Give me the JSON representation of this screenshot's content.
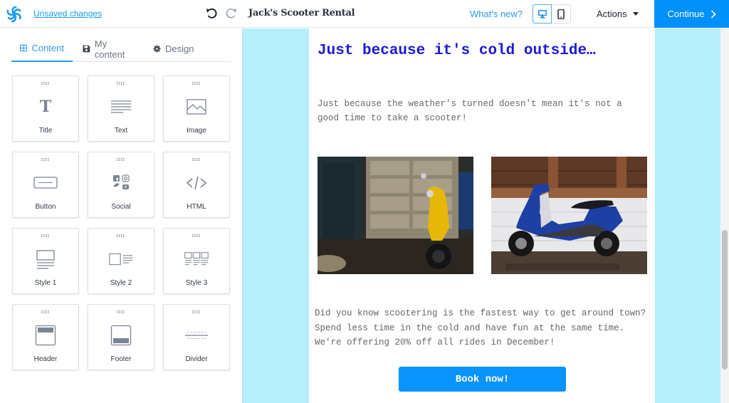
{
  "topbar": {
    "unsaved_label": "Unsaved changes",
    "doc_title": "Jack's Scooter Rental",
    "whats_new_label": "What's new?",
    "actions_label": "Actions",
    "continue_label": "Continue",
    "device_modes": [
      "desktop",
      "mobile"
    ],
    "active_device": "desktop"
  },
  "tabs": [
    {
      "label": "Content",
      "icon": "grid-icon",
      "active": true
    },
    {
      "label": "My content",
      "icon": "save-icon",
      "active": false
    },
    {
      "label": "Design",
      "icon": "gear-icon",
      "active": false
    }
  ],
  "blocks": [
    {
      "label": "Title",
      "icon": "title-icon"
    },
    {
      "label": "Text",
      "icon": "text-icon"
    },
    {
      "label": "Image",
      "icon": "image-icon"
    },
    {
      "label": "Button",
      "icon": "button-icon"
    },
    {
      "label": "Social",
      "icon": "social-icon"
    },
    {
      "label": "HTML",
      "icon": "code-icon"
    },
    {
      "label": "Style 1",
      "icon": "style1-icon"
    },
    {
      "label": "Style 2",
      "icon": "style2-icon"
    },
    {
      "label": "Style 3",
      "icon": "style3-icon"
    },
    {
      "label": "Header",
      "icon": "header-icon"
    },
    {
      "label": "Footer",
      "icon": "footer-icon"
    },
    {
      "label": "Divider",
      "icon": "divider-icon"
    }
  ],
  "email": {
    "headline": "Just because it's cold outside…",
    "intro": "Just because the weather's turned doesn't mean it's not a good time to take a scooter!",
    "image1": "yellow scooter in front of garage",
    "image2": "blue scooter in front of wooden fence",
    "body": "Did you know scootering is the fastest way to get around town? Spend less time in the cold and have fun at the same time. We're offering 20% off all rides in December!",
    "cta_label": "Book now!"
  },
  "colors": {
    "accent": "#0090fb",
    "canvas_bg": "#b6eefb",
    "headline": "#1a1ad6",
    "cta": "#0893fd"
  }
}
